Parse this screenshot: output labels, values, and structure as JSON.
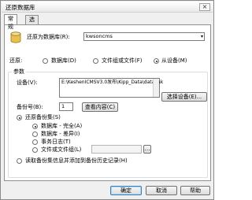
{
  "window": {
    "title": "还原数据库",
    "close_glyph": "×"
  },
  "tabs": [
    {
      "label": "常规",
      "active": true
    },
    {
      "label": "选项",
      "active": false
    }
  ],
  "general": {
    "restore_as_db_label": "还原为数据库(R):",
    "restore_as_db_value": "kwsoncms",
    "restore_label": "还原:",
    "restore_options": [
      {
        "label": "数据库(D)",
        "checked": false
      },
      {
        "label": "文件组或文件(F)",
        "checked": false
      },
      {
        "label": "从设备(M)",
        "checked": true
      }
    ],
    "params_group_title": "参数",
    "devices_label": "设备(V):",
    "device_path": "E:\\KeshenICMSV3.0发布\\Kipp_Data\\databak",
    "select_devices_button": "选择设备(E)...",
    "backup_number_label": "备份号(B):",
    "backup_number_value": "1",
    "view_contents_button": "查看内容(C)",
    "restore_backup_set_label": "还原备份集(S)",
    "restore_backup_set_checked": true,
    "backup_set_options": [
      {
        "label": "数据库 - 完全(A)",
        "checked": true
      },
      {
        "label": "数据库 - 差异(I)",
        "checked": false
      },
      {
        "label": "事务日志(T)",
        "checked": false
      },
      {
        "label": "文件或文件组(L)",
        "checked": false
      }
    ],
    "history_label": "读取备份集信息并添加到备份历史记录(H)",
    "history_checked": false
  },
  "footer": {
    "ok_button": "确定",
    "cancel_button": "取消",
    "help_button": "帮助"
  },
  "colors": {
    "accent": "#3c7fb1",
    "window_bg": "#f0f0f0",
    "panel_bg": "#ffffff"
  }
}
